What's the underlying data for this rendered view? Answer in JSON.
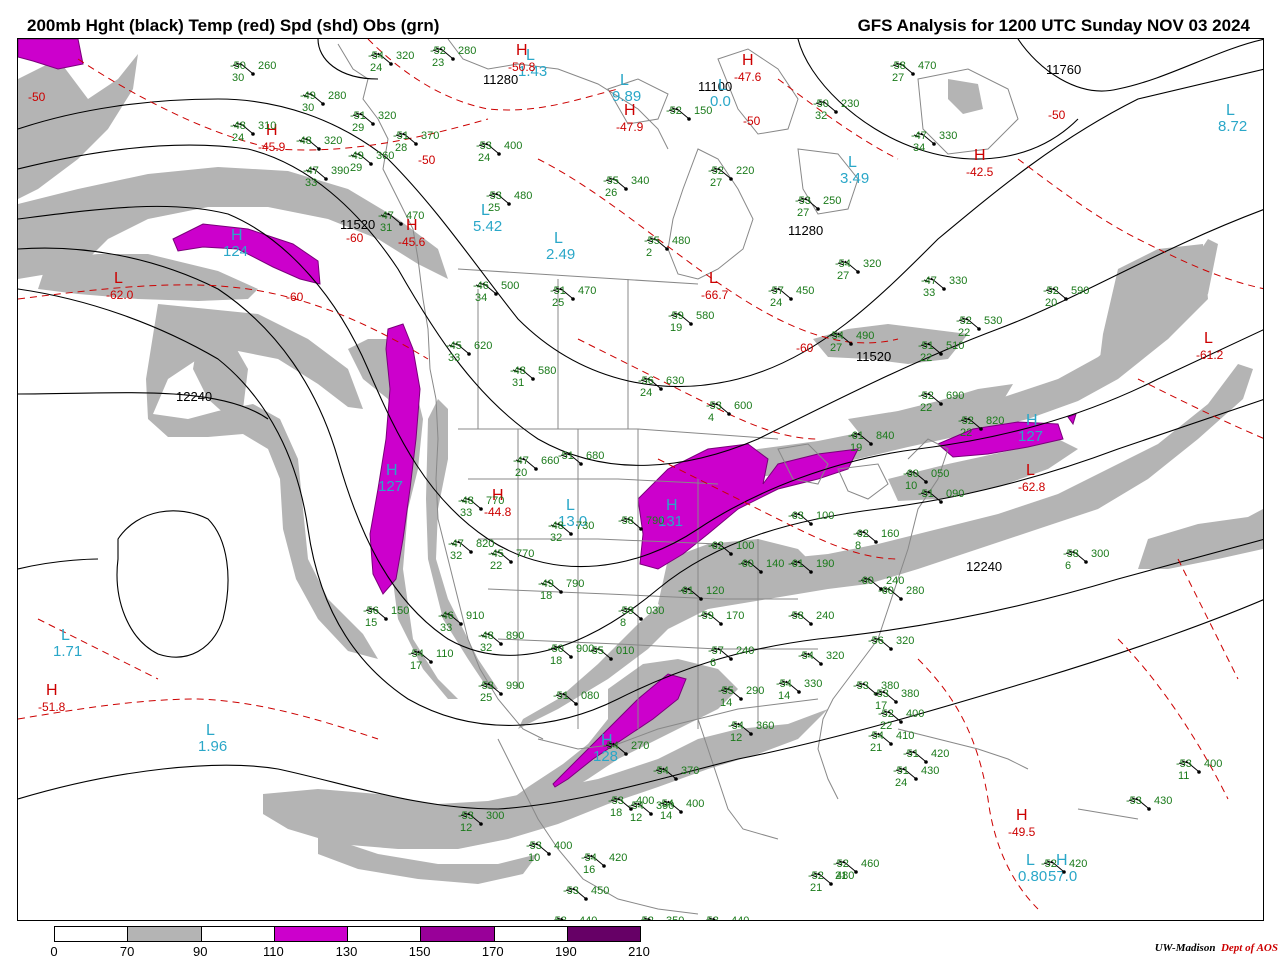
{
  "header": {
    "title_left": "200mb Hght (black) Temp (red) Spd (shd) Obs (grn)",
    "title_right": "GFS Analysis for 1200 UTC Sunday  NOV 03 2024"
  },
  "legend": {
    "ticks": [
      "0",
      "70",
      "90",
      "110",
      "130",
      "150",
      "170",
      "190",
      "210"
    ],
    "colors": [
      "#ffffff",
      "#b4b4b4",
      "#ffffff",
      "#cc00cc",
      "#ffffff",
      "#990099",
      "#ffffff",
      "#660066"
    ]
  },
  "credit": {
    "org": "UW-Madison",
    "dept": "Dept of AOS"
  },
  "colors": {
    "height_contour": "#000000",
    "temperature_contour": "#cc0000",
    "speed_shade_70": "#b4b4b4",
    "speed_shade_110": "#cc00cc",
    "observations": "#1a7a1a",
    "center_label": "#2aa7c8",
    "geography": "#888888"
  },
  "height_labels": [
    "11280",
    "11760",
    "11100",
    "11520",
    "12240",
    "11520",
    "11280",
    "12240"
  ],
  "temp_labels": [
    "-50",
    "-50",
    "-50",
    "-60",
    "-60",
    "-60",
    "-50"
  ],
  "centers": [
    {
      "kind": "L",
      "value": "1.43",
      "color": "#2aa7c8"
    },
    {
      "kind": "L",
      "value": "9.89",
      "color": "#2aa7c8"
    },
    {
      "kind": "L",
      "value": "0.0",
      "color": "#2aa7c8"
    },
    {
      "kind": "L",
      "value": "3.49",
      "color": "#2aa7c8"
    },
    {
      "kind": "L",
      "value": "8.72",
      "color": "#2aa7c8"
    },
    {
      "kind": "L",
      "value": "5.42",
      "color": "#2aa7c8"
    },
    {
      "kind": "L",
      "value": "2.49",
      "color": "#2aa7c8"
    },
    {
      "kind": "H",
      "value": "124",
      "color": "#2aa7c8"
    },
    {
      "kind": "H",
      "value": "127",
      "color": "#2aa7c8"
    },
    {
      "kind": "H",
      "value": "127",
      "color": "#2aa7c8"
    },
    {
      "kind": "H",
      "value": "131",
      "color": "#2aa7c8"
    },
    {
      "kind": "L",
      "value": "13.0",
      "color": "#2aa7c8"
    },
    {
      "kind": "H",
      "value": "128",
      "color": "#2aa7c8"
    },
    {
      "kind": "L",
      "value": "1.71",
      "color": "#2aa7c8"
    },
    {
      "kind": "L",
      "value": "1.96",
      "color": "#2aa7c8"
    },
    {
      "kind": "L",
      "value": "0.80",
      "color": "#2aa7c8"
    },
    {
      "kind": "H",
      "value": "57.0",
      "color": "#2aa7c8"
    },
    {
      "kind": "H",
      "value": "-50.8",
      "color": "#cc0000"
    },
    {
      "kind": "H",
      "value": "-47.6",
      "color": "#cc0000"
    },
    {
      "kind": "H",
      "value": "-47.9",
      "color": "#cc0000"
    },
    {
      "kind": "H",
      "value": "-45.9",
      "color": "#cc0000"
    },
    {
      "kind": "H",
      "value": "-42.5",
      "color": "#cc0000"
    },
    {
      "kind": "H",
      "value": "-45.6",
      "color": "#cc0000"
    },
    {
      "kind": "L",
      "value": "-62.0",
      "color": "#cc0000"
    },
    {
      "kind": "L",
      "value": "-66.7",
      "color": "#cc0000"
    },
    {
      "kind": "L",
      "value": "-61.2",
      "color": "#cc0000"
    },
    {
      "kind": "H",
      "value": "-44.8",
      "color": "#cc0000"
    },
    {
      "kind": "L",
      "value": "-62.8",
      "color": "#cc0000"
    },
    {
      "kind": "H",
      "value": "-51.8",
      "color": "#cc0000"
    },
    {
      "kind": "H",
      "value": "-49.5",
      "color": "#cc0000"
    }
  ],
  "observations": [
    {
      "t": "-50",
      "h": "260",
      "s": "30"
    },
    {
      "t": "-54",
      "h": "320",
      "s": "24"
    },
    {
      "t": "-52",
      "h": "280",
      "s": "23"
    },
    {
      "t": "-49",
      "h": "280",
      "s": "30"
    },
    {
      "t": "-51",
      "h": "320",
      "s": "29"
    },
    {
      "t": "-48",
      "h": "310",
      "s": "24"
    },
    {
      "t": "-51",
      "h": "370",
      "s": "28"
    },
    {
      "t": "-48",
      "h": "320",
      "s": ""
    },
    {
      "t": "-49",
      "h": "360",
      "s": "29"
    },
    {
      "t": "-47",
      "h": "390",
      "s": "33"
    },
    {
      "t": "-53",
      "h": "400",
      "s": "24"
    },
    {
      "t": "-52",
      "h": "150",
      "s": ""
    },
    {
      "t": "-55",
      "h": "340",
      "s": "26"
    },
    {
      "t": "-52",
      "h": "220",
      "s": "27"
    },
    {
      "t": "-50",
      "h": "230",
      "s": "32"
    },
    {
      "t": "-58",
      "h": "470",
      "s": "27"
    },
    {
      "t": "-47",
      "h": "330",
      "s": "34"
    },
    {
      "t": "-53",
      "h": "480",
      "s": "25"
    },
    {
      "t": "-53",
      "h": "250",
      "s": "27"
    },
    {
      "t": "-47",
      "h": "470",
      "s": "31"
    },
    {
      "t": "-55",
      "h": "480",
      "s": "2"
    },
    {
      "t": "-54",
      "h": "320",
      "s": "27"
    },
    {
      "t": "-46",
      "h": "500",
      "s": "34"
    },
    {
      "t": "-51",
      "h": "470",
      "s": "25"
    },
    {
      "t": "-57",
      "h": "450",
      "s": "24"
    },
    {
      "t": "-47",
      "h": "330",
      "s": "33"
    },
    {
      "t": "-52",
      "h": "590",
      "s": "20"
    },
    {
      "t": "-59",
      "h": "580",
      "s": "19"
    },
    {
      "t": "-54",
      "h": "490",
      "s": "27"
    },
    {
      "t": "-52",
      "h": "530",
      "s": "22"
    },
    {
      "t": "-45",
      "h": "620",
      "s": "33"
    },
    {
      "t": "-51",
      "h": "510",
      "s": "22"
    },
    {
      "t": "-48",
      "h": "580",
      "s": "31"
    },
    {
      "t": "-56",
      "h": "630",
      "s": "24"
    },
    {
      "t": "-52",
      "h": "690",
      "s": "22"
    },
    {
      "t": "-53",
      "h": "600",
      "s": "4"
    },
    {
      "t": "-52",
      "h": "820",
      "s": "22"
    },
    {
      "t": "-47",
      "h": "660",
      "s": "20"
    },
    {
      "t": "-51",
      "h": "680",
      "s": ""
    },
    {
      "t": "-61",
      "h": "840",
      "s": "19"
    },
    {
      "t": "-60",
      "h": "050",
      "s": "10"
    },
    {
      "t": "-48",
      "h": "770",
      "s": "33"
    },
    {
      "t": "-48",
      "h": "730",
      "s": "32"
    },
    {
      "t": "-58",
      "h": "790",
      "s": ""
    },
    {
      "t": "-51",
      "h": "090",
      "s": ""
    },
    {
      "t": "-47",
      "h": "820",
      "s": "32"
    },
    {
      "t": "-45",
      "h": "770",
      "s": "22"
    },
    {
      "t": "-62",
      "h": "100",
      "s": ""
    },
    {
      "t": "-63",
      "h": "100",
      "s": ""
    },
    {
      "t": "-62",
      "h": "160",
      "s": "8"
    },
    {
      "t": "-58",
      "h": "300",
      "s": "6"
    },
    {
      "t": "-49",
      "h": "790",
      "s": "18"
    },
    {
      "t": "-59",
      "h": "030",
      "s": "8"
    },
    {
      "t": "-61",
      "h": "120",
      "s": ""
    },
    {
      "t": "-60",
      "h": "140",
      "s": ""
    },
    {
      "t": "-61",
      "h": "190",
      "s": ""
    },
    {
      "t": "-60",
      "h": "240",
      "s": ""
    },
    {
      "t": "-60",
      "h": "280",
      "s": ""
    },
    {
      "t": "-56",
      "h": "150",
      "s": "15"
    },
    {
      "t": "-46",
      "h": "910",
      "s": "33"
    },
    {
      "t": "-48",
      "h": "890",
      "s": "32"
    },
    {
      "t": "-50",
      "h": "900",
      "s": "18"
    },
    {
      "t": "-55",
      "h": "010",
      "s": ""
    },
    {
      "t": "-59",
      "h": "170",
      "s": ""
    },
    {
      "t": "-58",
      "h": "240",
      "s": ""
    },
    {
      "t": "-56",
      "h": "320",
      "s": ""
    },
    {
      "t": "-54",
      "h": "110",
      "s": "17"
    },
    {
      "t": "-57",
      "h": "240",
      "s": "6"
    },
    {
      "t": "-54",
      "h": "320",
      "s": ""
    },
    {
      "t": "-53",
      "h": "990",
      "s": "25"
    },
    {
      "t": "-51",
      "h": "080",
      "s": ""
    },
    {
      "t": "-55",
      "h": "290",
      "s": "14"
    },
    {
      "t": "-54",
      "h": "330",
      "s": "14"
    },
    {
      "t": "-53",
      "h": "380",
      "s": ""
    },
    {
      "t": "-53",
      "h": "380",
      "s": "17"
    },
    {
      "t": "-52",
      "h": "400",
      "s": "22"
    },
    {
      "t": "-54",
      "h": "360",
      "s": "12"
    },
    {
      "t": "-54",
      "h": "410",
      "s": "21"
    },
    {
      "t": "-51",
      "h": "420",
      "s": ""
    },
    {
      "t": "-51",
      "h": "430",
      "s": "24"
    },
    {
      "t": "-54",
      "h": "270",
      "s": ""
    },
    {
      "t": "-54",
      "h": "370",
      "s": ""
    },
    {
      "t": "-53",
      "h": "400",
      "s": "18"
    },
    {
      "t": "-54",
      "h": "390",
      "s": "12"
    },
    {
      "t": "-54",
      "h": "400",
      "s": "14"
    },
    {
      "t": "-53",
      "h": "300",
      "s": "12"
    },
    {
      "t": "-53",
      "h": "400",
      "s": "10"
    },
    {
      "t": "-54",
      "h": "420",
      "s": "16"
    },
    {
      "t": "-53",
      "h": "450",
      "s": ""
    },
    {
      "t": "-53",
      "h": "440",
      "s": ""
    },
    {
      "t": "-52",
      "h": "350",
      "s": ""
    },
    {
      "t": "-53",
      "h": "440",
      "s": ""
    },
    {
      "t": "-52",
      "h": "460",
      "s": "21"
    },
    {
      "t": "-52",
      "h": "480",
      "s": "21"
    },
    {
      "t": "-53",
      "h": "400",
      "s": "11"
    },
    {
      "t": "-53",
      "h": "430",
      "s": ""
    },
    {
      "t": "-52",
      "h": "420",
      "s": ""
    }
  ]
}
